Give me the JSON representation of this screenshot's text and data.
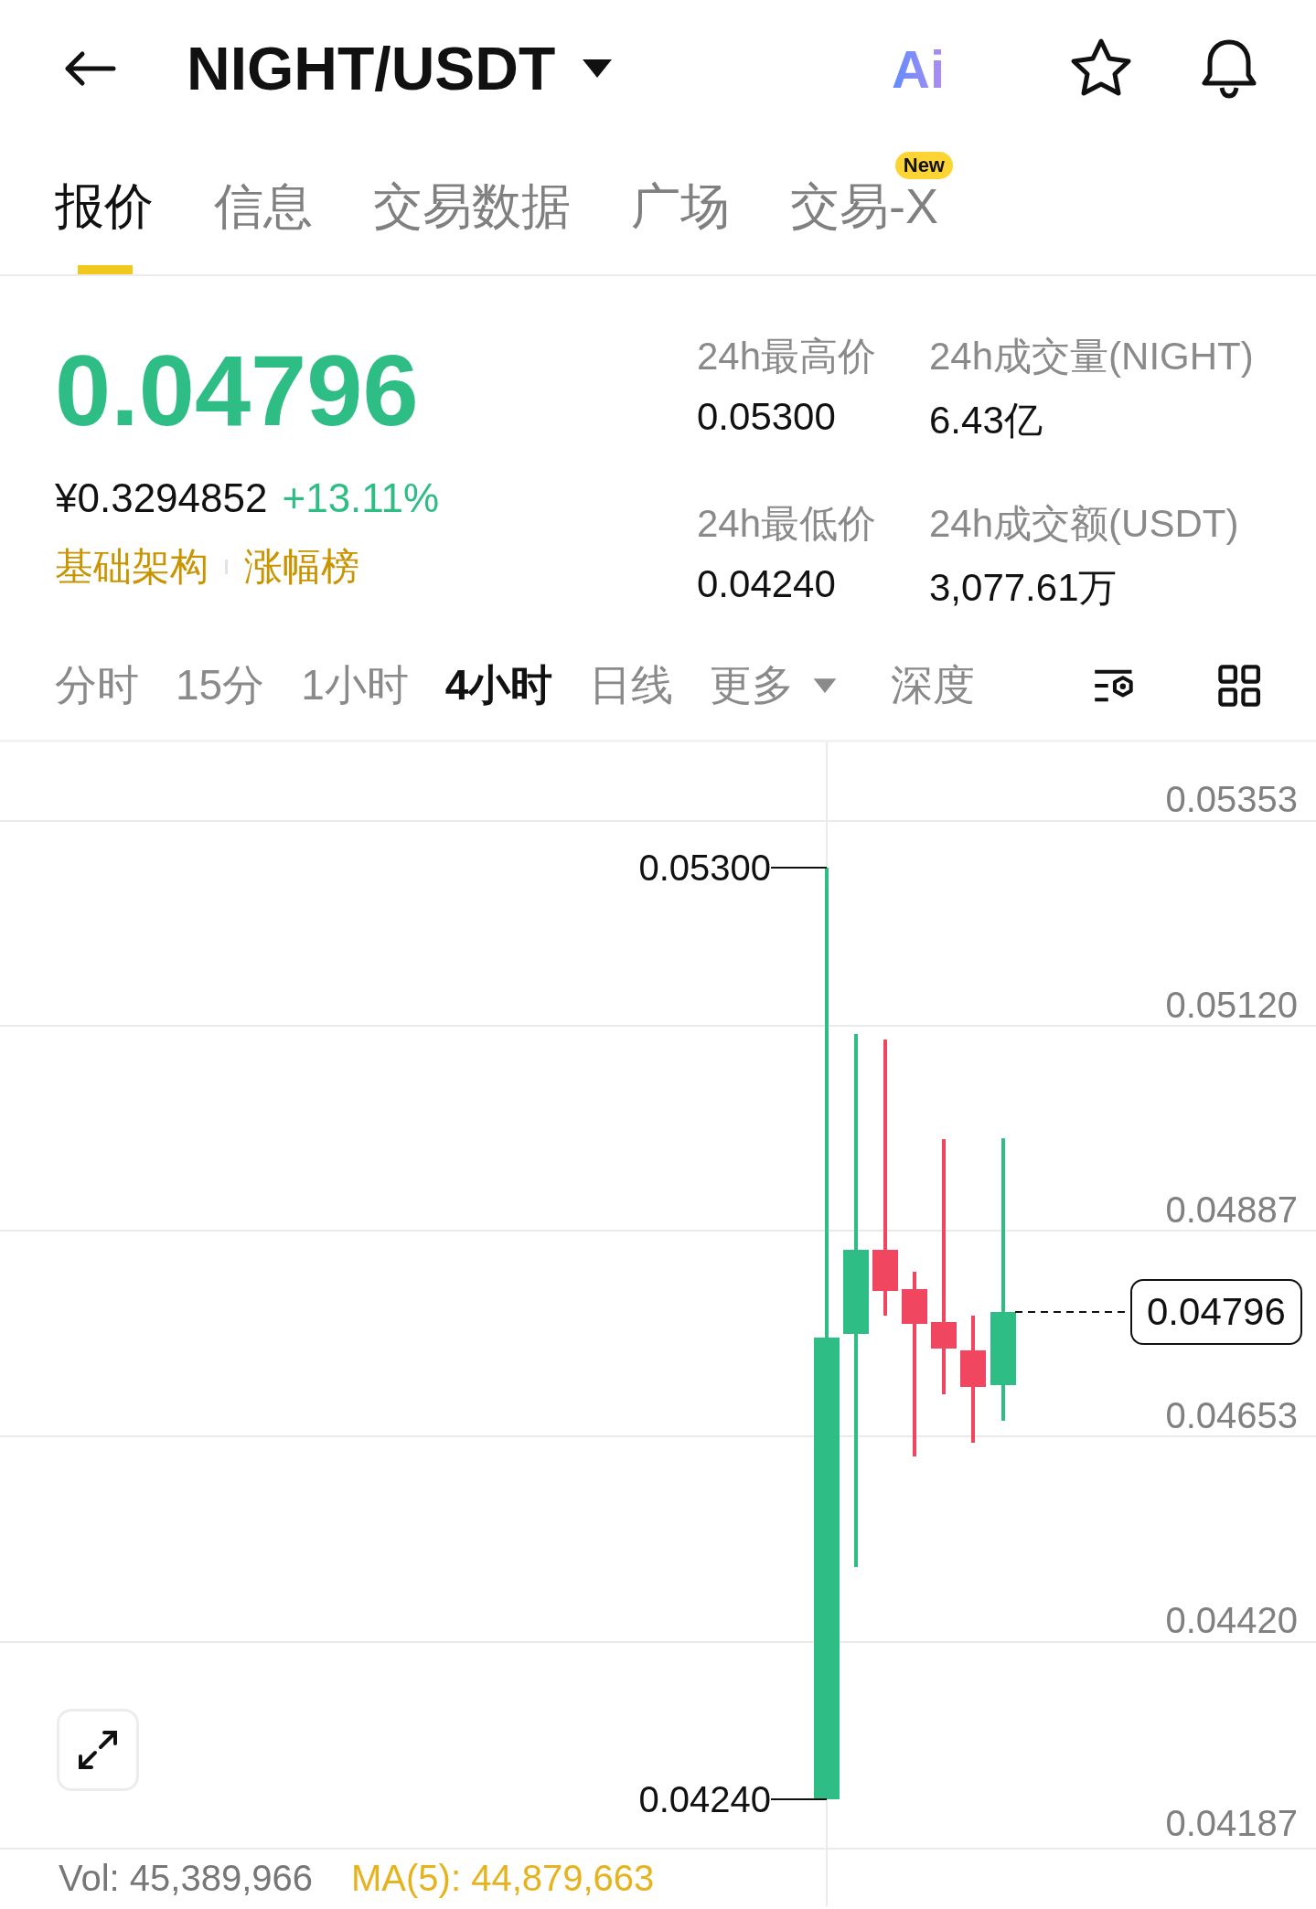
{
  "header": {
    "pair": "NIGHT/USDT",
    "ai_label": "Ai"
  },
  "tabs": [
    {
      "label": "报价",
      "selected": true
    },
    {
      "label": "信息",
      "selected": false
    },
    {
      "label": "交易数据",
      "selected": false
    },
    {
      "label": "广场",
      "selected": false
    },
    {
      "label": "交易-X",
      "selected": false,
      "badge": "New"
    }
  ],
  "ticker": {
    "last_price": "0.04796",
    "cny_price": "¥0.3294852",
    "change": "+13.11%",
    "tags": [
      "基础架构",
      "涨幅榜"
    ]
  },
  "stats": [
    {
      "label": "24h最高价",
      "value": "0.05300"
    },
    {
      "label": "24h成交量(NIGHT)",
      "value": "6.43亿"
    },
    {
      "label": "24h最低价",
      "value": "0.04240"
    },
    {
      "label": "24h成交额(USDT)",
      "value": "3,077.61万"
    }
  ],
  "intervals": [
    {
      "label": "分时",
      "selected": false,
      "kind": "option"
    },
    {
      "label": "15分",
      "selected": false,
      "kind": "option"
    },
    {
      "label": "1小时",
      "selected": false,
      "kind": "option"
    },
    {
      "label": "4小时",
      "selected": true,
      "kind": "option"
    },
    {
      "label": "日线",
      "selected": false,
      "kind": "option"
    },
    {
      "label": "更多",
      "selected": false,
      "kind": "dropdown"
    },
    {
      "label": "深度",
      "selected": false,
      "kind": "option"
    }
  ],
  "chart": {
    "price_axis": [
      "0.05353",
      "0.05120",
      "0.04887",
      "0.04653",
      "0.04420",
      "0.04187"
    ],
    "high_marker": "0.05300",
    "low_marker": "0.04240",
    "last_price_tag": "0.04796"
  },
  "volume": {
    "vol": "Vol: 45,389,966",
    "ma": "MA(5): 44,879,663"
  }
}
